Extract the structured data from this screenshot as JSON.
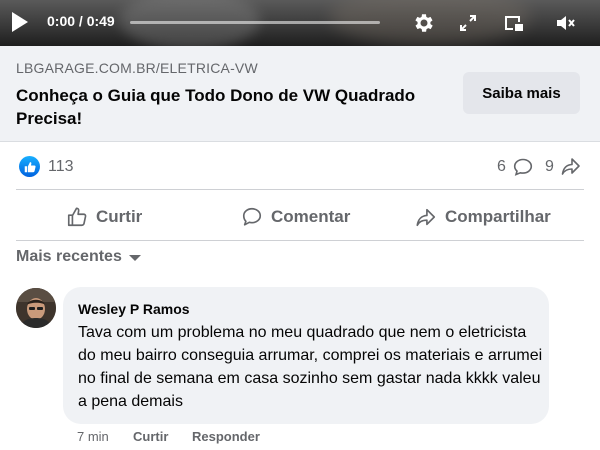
{
  "video": {
    "time": "0:00 / 0:49",
    "progress": 0.0,
    "icons": [
      "play-icon",
      "settings-gear-icon",
      "fullscreen-icon",
      "pip-icon",
      "muted-speaker-icon"
    ]
  },
  "link_preview": {
    "domain": "LBGARAGE.COM.BR/ELETRICA-VW",
    "title": "Conheça o Guia que Todo Dono de VW Quadrado Precisa!",
    "cta": "Saiba mais"
  },
  "reactions": {
    "likes": "113",
    "comments": "6",
    "shares": "9"
  },
  "actions": {
    "like": "Curtir",
    "comment": "Comentar",
    "share": "Compartilhar"
  },
  "sort": {
    "label": "Mais recentes"
  },
  "comment": {
    "author": "Wesley P Ramos",
    "text": "Tava com um problema no meu quadrado que nem o eletricista do meu bairro conseguia arrumar, comprei os materiais e arrumei no final de semana em casa sozinho sem gastar nada kkkk valeu a pena demais",
    "time": "7 min",
    "like_link": "Curtir",
    "reply_link": "Responder"
  },
  "colors": {
    "accent_blue": "#0866ff",
    "secondary_text": "#65676b",
    "bubble_bg": "#f0f2f5"
  }
}
